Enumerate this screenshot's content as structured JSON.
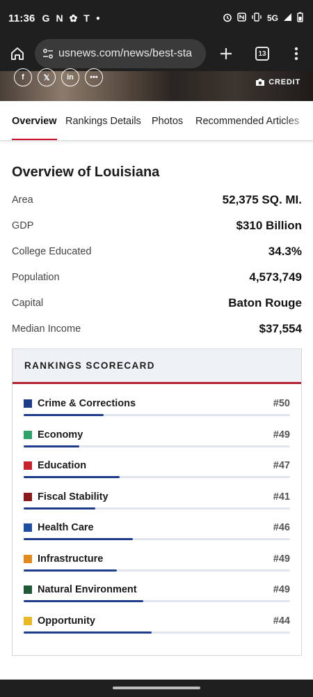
{
  "status_bar": {
    "time": "11:36",
    "left_icons": [
      "g-icon",
      "n-icon",
      "pinwheel-icon",
      "t-mobile-icon",
      "dot-icon"
    ],
    "network": "5G"
  },
  "browser": {
    "url": "usnews.com/news/best-sta",
    "tab_count": "13"
  },
  "hero": {
    "credit_label": "CREDIT"
  },
  "tabs": [
    {
      "label": "Overview",
      "active": true
    },
    {
      "label": "Rankings Details",
      "active": false
    },
    {
      "label": "Photos",
      "active": false
    },
    {
      "label": "Recommended Articles",
      "active": false
    }
  ],
  "overview": {
    "title": "Overview of Louisiana",
    "facts": [
      {
        "label": "Area",
        "value": "52,375 SQ. MI."
      },
      {
        "label": "GDP",
        "value": "$310 Billion"
      },
      {
        "label": "College Educated",
        "value": "34.3%"
      },
      {
        "label": "Population",
        "value": "4,573,749"
      },
      {
        "label": "Capital",
        "value": "Baton Rouge"
      },
      {
        "label": "Median Income",
        "value": "$37,554"
      }
    ]
  },
  "scorecard": {
    "title": "RANKINGS SCORECARD",
    "items": [
      {
        "name": "Crime & Corrections",
        "rank": "#50",
        "color": "#1d3c8a",
        "bar": 0.3
      },
      {
        "name": "Economy",
        "rank": "#49",
        "color": "#2fa36b",
        "bar": 0.21
      },
      {
        "name": "Education",
        "rank": "#47",
        "color": "#c8232c",
        "bar": 0.36
      },
      {
        "name": "Fiscal Stability",
        "rank": "#41",
        "color": "#8b1a1a",
        "bar": 0.27
      },
      {
        "name": "Health Care",
        "rank": "#46",
        "color": "#1d4fa0",
        "bar": 0.41
      },
      {
        "name": "Infrastructure",
        "rank": "#49",
        "color": "#e08a1e",
        "bar": 0.35
      },
      {
        "name": "Natural Environment",
        "rank": "#49",
        "color": "#1e5a36",
        "bar": 0.45
      },
      {
        "name": "Opportunity",
        "rank": "#44",
        "color": "#e8b923",
        "bar": 0.48
      }
    ]
  }
}
